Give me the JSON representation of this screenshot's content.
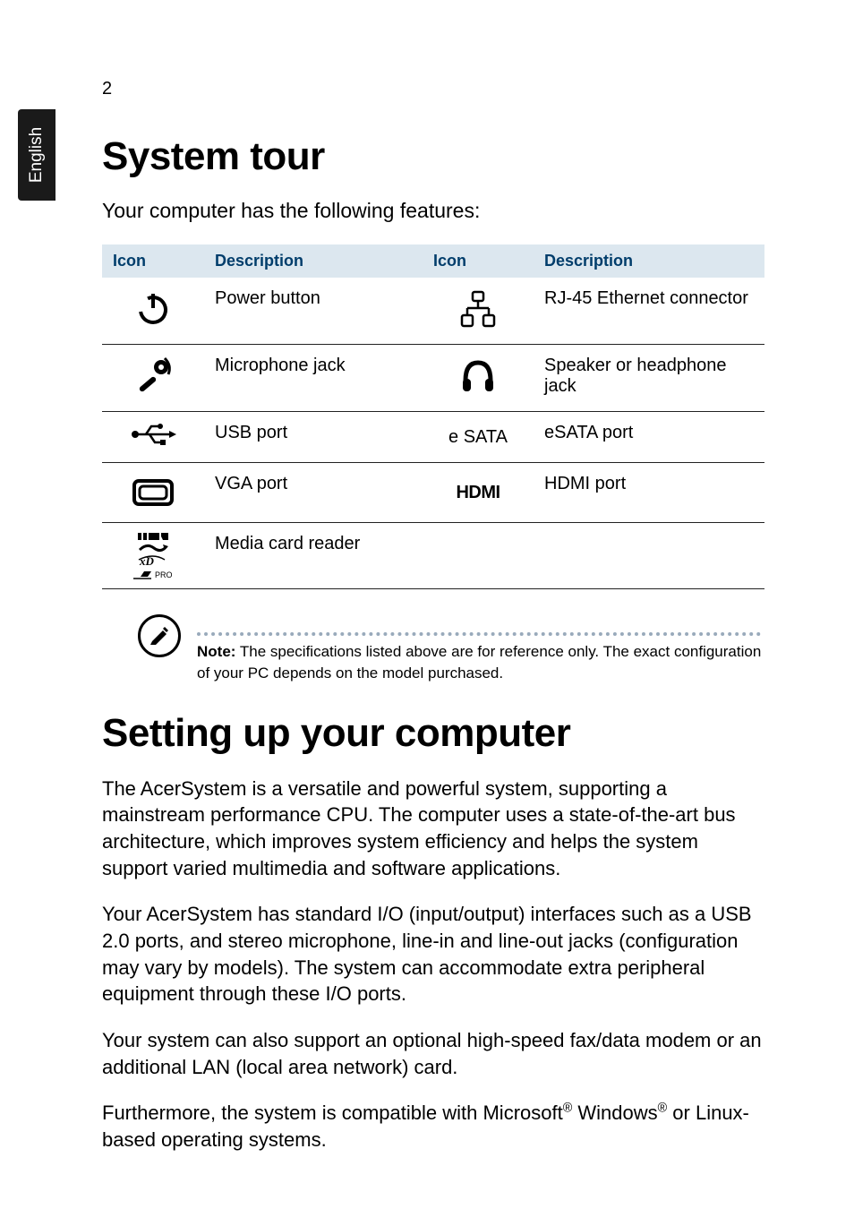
{
  "page": {
    "number": "2",
    "language": "English"
  },
  "heading1": "System tour",
  "lead1": "Your computer has the following features:",
  "table": {
    "headers": {
      "icon": "Icon",
      "description": "Description",
      "icon2": "Icon",
      "description2": "Description"
    },
    "rows": [
      {
        "desc": "Power button",
        "icon2_text": "",
        "desc2": "RJ-45 Ethernet connector"
      },
      {
        "desc": "Microphone jack",
        "icon2_text": "",
        "desc2": "Speaker or headphone jack"
      },
      {
        "desc": "USB port",
        "icon2_text": "e SATA",
        "desc2": "eSATA port"
      },
      {
        "desc": "VGA port",
        "icon2_text": "HDMI",
        "desc2": "HDMI port"
      },
      {
        "desc": "Media card reader",
        "icon2_text": "",
        "desc2": ""
      }
    ],
    "media_card_label": "PRO"
  },
  "note": {
    "label": "Note:",
    "text": " The specifications listed above are for reference only. The exact configuration of your PC depends on the model purchased."
  },
  "heading2": "Setting up your computer",
  "para1": "The AcerSystem is a versatile and powerful system, supporting a mainstream performance CPU. The computer uses a state-of-the-art bus architecture, which improves system efficiency and helps the system support varied multimedia and software applications.",
  "para2": "Your AcerSystem has standard I/O (input/output) interfaces such as a USB 2.0 ports, and stereo microphone, line-in and line-out jacks (configuration may vary by models). The system can accommodate extra peripheral equipment through these I/O ports.",
  "para3": "Your system can also support an optional high-speed fax/data modem or an additional LAN (local area network) card.",
  "para4_pre": "Furthermore, the system is compatible with Microsoft",
  "para4_mid": " Windows",
  "para4_post": " or Linux-based operating systems.",
  "reg_mark": "®"
}
